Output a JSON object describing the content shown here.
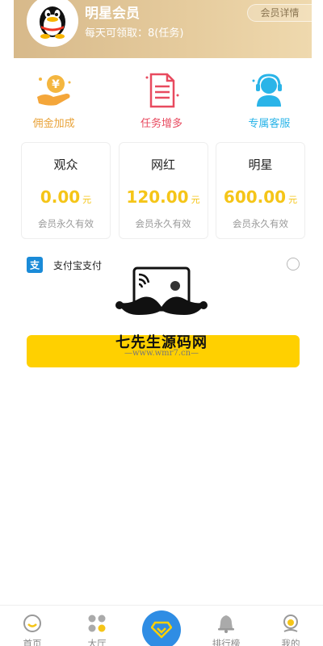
{
  "header": {
    "member_title": "明星会员",
    "member_sub": "每天可领取：8(任务)",
    "detail_button": "会员详情"
  },
  "features": [
    {
      "label": "佣金加成",
      "color": "#e9a33a",
      "icon": "coin-hand-icon"
    },
    {
      "label": "任务增多",
      "color": "#e84a5f",
      "icon": "document-icon"
    },
    {
      "label": "专属客服",
      "color": "#2ab4e8",
      "icon": "customer-service-icon"
    }
  ],
  "plans": [
    {
      "name": "观众",
      "price": "0.00",
      "unit": "元",
      "validity": "会员永久有效"
    },
    {
      "name": "网红",
      "price": "120.00",
      "unit": "元",
      "validity": "会员永久有效"
    },
    {
      "name": "明星",
      "price": "600.00",
      "unit": "元",
      "validity": "会员永久有效"
    }
  ],
  "payment": {
    "method_label": "支付宝支付",
    "selected": false
  },
  "watermark": {
    "title": "七先生源码网",
    "url": "—www.wmr7.cn—"
  },
  "nav": [
    {
      "label": "首页",
      "icon": "home-icon"
    },
    {
      "label": "大厅",
      "icon": "hall-icon"
    },
    {
      "label": "",
      "icon": "diamond-icon"
    },
    {
      "label": "排行榜",
      "icon": "bell-icon"
    },
    {
      "label": "我的",
      "icon": "profile-icon"
    }
  ],
  "colors": {
    "accent_gold": "#f5c518",
    "button_yellow": "#ffd000",
    "nav_center_blue": "#2f8de4"
  }
}
